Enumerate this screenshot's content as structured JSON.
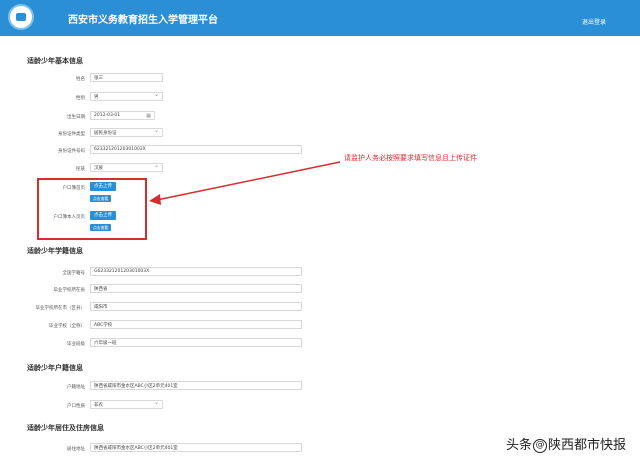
{
  "app": {
    "title": "西安市义务教育招生入学管理平台",
    "logout_label": "退出登录"
  },
  "sections": {
    "basic": "适龄少年基本信息",
    "school_record": "适龄少年学籍信息",
    "household": "适龄少年户籍信息",
    "residence": "适龄少年居住及住房信息"
  },
  "basic": {
    "name": {
      "label": "姓名",
      "value": "张三"
    },
    "gender": {
      "label": "性别",
      "value": "男"
    },
    "birth_date": {
      "label": "出生日期",
      "value": "2012-03-01"
    },
    "id_type": {
      "label": "身份证件类型",
      "value": "居民身份证"
    },
    "id_number": {
      "label": "身份证件号码",
      "value": "62332120120301003X"
    },
    "ethnicity": {
      "label": "民族",
      "value": "汉族"
    },
    "hukou_home": {
      "label": "户口簿首页",
      "upload_label": "点击上传",
      "view_label": "点击查看"
    },
    "hukou_personal": {
      "label": "户口簿本人页页",
      "upload_label": "点击上传",
      "view_label": "点击查看"
    }
  },
  "school_record": {
    "student_id": {
      "label": "全国学籍号",
      "value": "G62332120120301003X"
    },
    "grad_province": {
      "label": "毕业学校所在省",
      "value": "陕西省"
    },
    "grad_city": {
      "label": "毕业学校所在市（区县）",
      "value": "咸阳市"
    },
    "grad_school": {
      "label": "毕业学校（全称）",
      "value": "ABC学校"
    },
    "grad_class": {
      "label": "毕业班级",
      "value": "六年级一班"
    }
  },
  "household": {
    "address": {
      "label": "户籍地址",
      "value": "陕西省咸阳市金水区ABC小区2单元401室"
    },
    "type": {
      "label": "户口性质",
      "value": "非农"
    }
  },
  "residence": {
    "address": {
      "label": "居住地址",
      "value": "陕西省咸阳市金水区ABC小区2单元401室"
    }
  },
  "annotation": {
    "text": "请监护人务必按照要求填写信息且上传证件",
    "color": "#d32f2f"
  },
  "watermark": {
    "prefix": "头条",
    "circle": "@",
    "name": "陕西都市快报"
  },
  "colors": {
    "brand": "#2b8fd6",
    "alert": "#d32f2f"
  }
}
